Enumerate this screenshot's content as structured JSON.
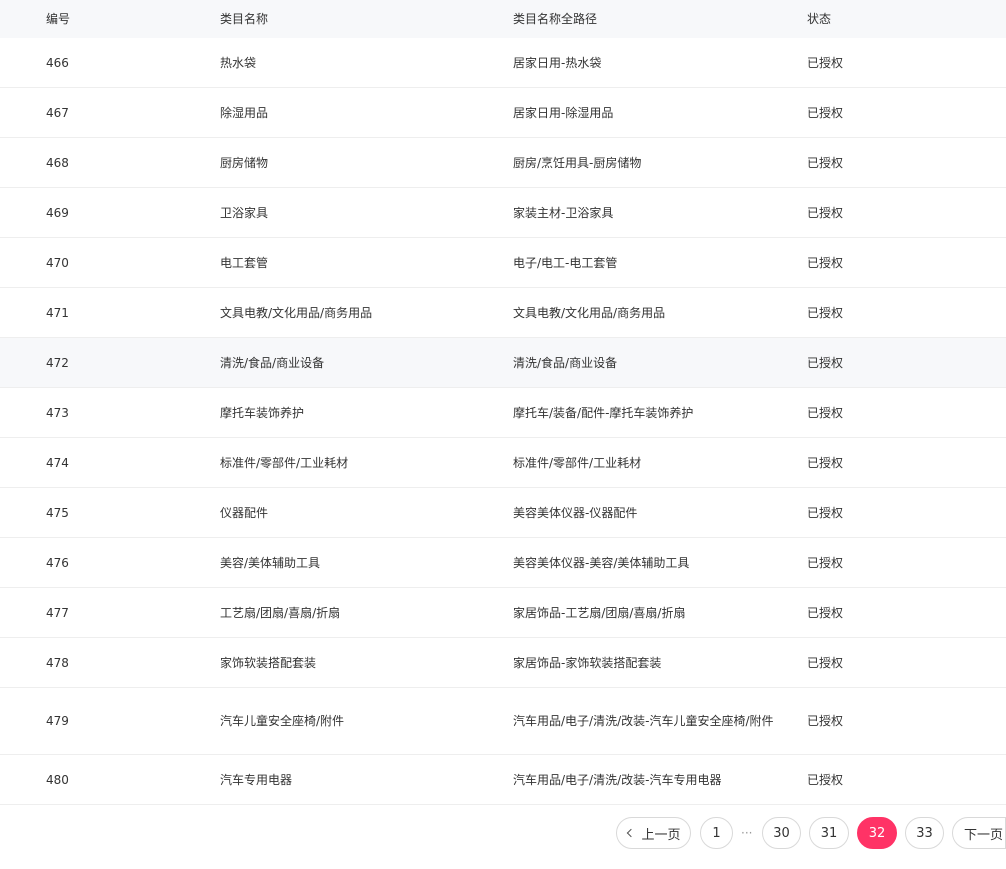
{
  "table": {
    "headers": {
      "id": "编号",
      "name": "类目名称",
      "path": "类目名称全路径",
      "status": "状态"
    },
    "rows": [
      {
        "id": "466",
        "name": "热水袋",
        "path": "居家日用-热水袋",
        "status": "已授权"
      },
      {
        "id": "467",
        "name": "除湿用品",
        "path": "居家日用-除湿用品",
        "status": "已授权"
      },
      {
        "id": "468",
        "name": "厨房储物",
        "path": "厨房/烹饪用具-厨房储物",
        "status": "已授权"
      },
      {
        "id": "469",
        "name": "卫浴家具",
        "path": "家装主材-卫浴家具",
        "status": "已授权"
      },
      {
        "id": "470",
        "name": "电工套管",
        "path": "电子/电工-电工套管",
        "status": "已授权"
      },
      {
        "id": "471",
        "name": "文具电教/文化用品/商务用品",
        "path": "文具电教/文化用品/商务用品",
        "status": "已授权"
      },
      {
        "id": "472",
        "name": "清洗/食品/商业设备",
        "path": "清洗/食品/商业设备",
        "status": "已授权"
      },
      {
        "id": "473",
        "name": "摩托车装饰养护",
        "path": "摩托车/装备/配件-摩托车装饰养护",
        "status": "已授权"
      },
      {
        "id": "474",
        "name": "标准件/零部件/工业耗材",
        "path": "标准件/零部件/工业耗材",
        "status": "已授权"
      },
      {
        "id": "475",
        "name": "仪器配件",
        "path": "美容美体仪器-仪器配件",
        "status": "已授权"
      },
      {
        "id": "476",
        "name": "美容/美体辅助工具",
        "path": "美容美体仪器-美容/美体辅助工具",
        "status": "已授权"
      },
      {
        "id": "477",
        "name": "工艺扇/团扇/喜扇/折扇",
        "path": "家居饰品-工艺扇/团扇/喜扇/折扇",
        "status": "已授权"
      },
      {
        "id": "478",
        "name": "家饰软装搭配套装",
        "path": "家居饰品-家饰软装搭配套装",
        "status": "已授权"
      },
      {
        "id": "479",
        "name": "汽车儿童安全座椅/附件",
        "path": "汽车用品/电子/清洗/改装-汽车儿童安全座椅/附件",
        "status": "已授权"
      },
      {
        "id": "480",
        "name": "汽车专用电器",
        "path": "汽车用品/电子/清洗/改装-汽车专用电器",
        "status": "已授权"
      }
    ]
  },
  "pagination": {
    "prev_label": "上一页",
    "first_page": "1",
    "ellipsis": "···",
    "pages": [
      "30",
      "31",
      "32",
      "33"
    ],
    "current_page": "32",
    "next_label": "下一页",
    "accent_color": "#ff3366"
  }
}
